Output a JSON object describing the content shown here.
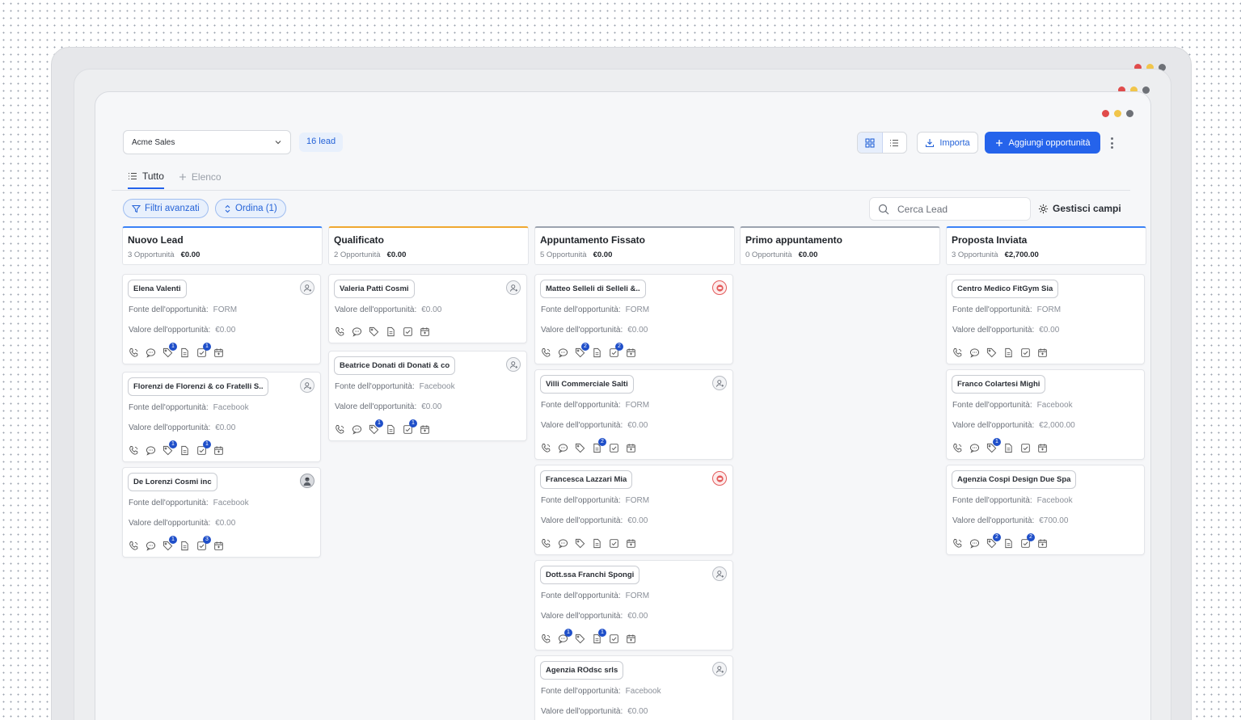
{
  "pipeline": {
    "selected": "Acme Sales"
  },
  "lead_count": "16 lead",
  "toolbar": {
    "import_label": "Importa",
    "add_label": "Aggiungi opportunità"
  },
  "tabs": [
    {
      "label": "Tutto"
    },
    {
      "label": "Elenco"
    }
  ],
  "filters": {
    "advanced_label": "Filtri avanzati",
    "sort_label": "Ordina (1)"
  },
  "search": {
    "placeholder": "Cerca Lead"
  },
  "manage_fields_label": "Gestisci campi",
  "labels": {
    "source": "Fonte dell'opportunità:",
    "value": "Valore dell'opportunità:"
  },
  "colors": {
    "accent": "#2563eb",
    "nuovo": "#3b82f6",
    "qualificato": "#f0a830",
    "appuntamento": "#9ca3af",
    "primo": "#9ca3af",
    "proposta": "#3b82f6"
  },
  "columns": [
    {
      "title": "Nuovo Lead",
      "count": "3 Opportunità",
      "total": "€0.00",
      "cards": [
        {
          "name": "Elena Valenti",
          "row1_label": "Fonte dell'opportunità:",
          "row1_value": "FORM",
          "row2_label": "Valore dell'opportunità:",
          "row2_value": "€0.00",
          "avatar": "user",
          "badges": {
            "tag": "1",
            "task": "1"
          }
        },
        {
          "name": "Florenzi de Florenzi & co Fratelli S..",
          "row1_label": "Fonte dell'opportunità:",
          "row1_value": "Facebook",
          "row2_label": "Valore dell'opportunità:",
          "row2_value": "€0.00",
          "avatar": "user",
          "badges": {
            "tag": "1",
            "task": "1"
          }
        },
        {
          "name": "De Lorenzi Cosmi inc",
          "row1_label": "Fonte dell'opportunità:",
          "row1_value": "Facebook",
          "row2_label": "Valore dell'opportunità:",
          "row2_value": "€0.00",
          "avatar": "photo",
          "badges": {
            "tag": "1",
            "task": "3"
          }
        }
      ]
    },
    {
      "title": "Qualificato",
      "count": "2 Opportunità",
      "total": "€0.00",
      "cards": [
        {
          "name": "Valeria Patti Cosmi",
          "row1_label": "Valore dell'opportunità:",
          "row1_value": "€0.00",
          "row2_label": "",
          "row2_value": "",
          "avatar": "user",
          "badges": {}
        },
        {
          "name": "Beatrice Donati di Donati & co",
          "row1_label": "Fonte dell'opportunità:",
          "row1_value": "Facebook",
          "row2_label": "Valore dell'opportunità:",
          "row2_value": "€0.00",
          "avatar": "user",
          "badges": {
            "tag": "1",
            "task": "1"
          }
        }
      ]
    },
    {
      "title": "Appuntamento Fissato",
      "count": "5 Opportunità",
      "total": "€0.00",
      "cards": [
        {
          "name": "Matteo Selleli di Selleli &..",
          "row1_label": "Fonte dell'opportunità:",
          "row1_value": "FORM",
          "row2_label": "Valore dell'opportunità:",
          "row2_value": "€0.00",
          "avatar": "red",
          "badges": {
            "tag": "2",
            "task": "2"
          }
        },
        {
          "name": "Villi Commerciale Salti",
          "row1_label": "Fonte dell'opportunità:",
          "row1_value": "FORM",
          "row2_label": "Valore dell'opportunità:",
          "row2_value": "€0.00",
          "avatar": "user",
          "badges": {
            "doc": "2"
          }
        },
        {
          "name": "Francesca Lazzari Mia",
          "row1_label": "Fonte dell'opportunità:",
          "row1_value": "FORM",
          "row2_label": "Valore dell'opportunità:",
          "row2_value": "€0.00",
          "avatar": "red",
          "badges": {}
        },
        {
          "name": "Dott.ssa Franchi Spongi",
          "row1_label": "Fonte dell'opportunità:",
          "row1_value": "FORM",
          "row2_label": "Valore dell'opportunità:",
          "row2_value": "€0.00",
          "avatar": "user",
          "badges": {
            "chat": "1",
            "doc": "1"
          }
        },
        {
          "name": "Agenzia ROdsc srls",
          "row1_label": "Fonte dell'opportunità:",
          "row1_value": "Facebook",
          "row2_label": "Valore dell'opportunità:",
          "row2_value": "€0.00",
          "avatar": "user",
          "badges": {}
        }
      ]
    },
    {
      "title": "Primo appuntamento",
      "count": "0 Opportunità",
      "total": "€0.00",
      "cards": []
    },
    {
      "title": "Proposta Inviata",
      "count": "3 Opportunità",
      "total": "€2,700.00",
      "cards": [
        {
          "name": "Centro Medico FitGym Sia",
          "row1_label": "Fonte dell'opportunità:",
          "row1_value": "FORM",
          "row2_label": "Valore dell'opportunità:",
          "row2_value": "€0.00",
          "avatar": "none",
          "badges": {}
        },
        {
          "name": "Franco Colartesi Mighi",
          "row1_label": "Fonte dell'opportunità:",
          "row1_value": "Facebook",
          "row2_label": "Valore dell'opportunità:",
          "row2_value": "€2,000.00",
          "avatar": "none",
          "badges": {
            "tag": "1"
          }
        },
        {
          "name": "Agenzia Cospi Design Due Spa",
          "row1_label": "Fonte dell'opportunità:",
          "row1_value": "Facebook",
          "row2_label": "Valore dell'opportunità:",
          "row2_value": "€700.00",
          "avatar": "none",
          "badges": {
            "tag": "2",
            "task": "2"
          }
        }
      ]
    }
  ]
}
